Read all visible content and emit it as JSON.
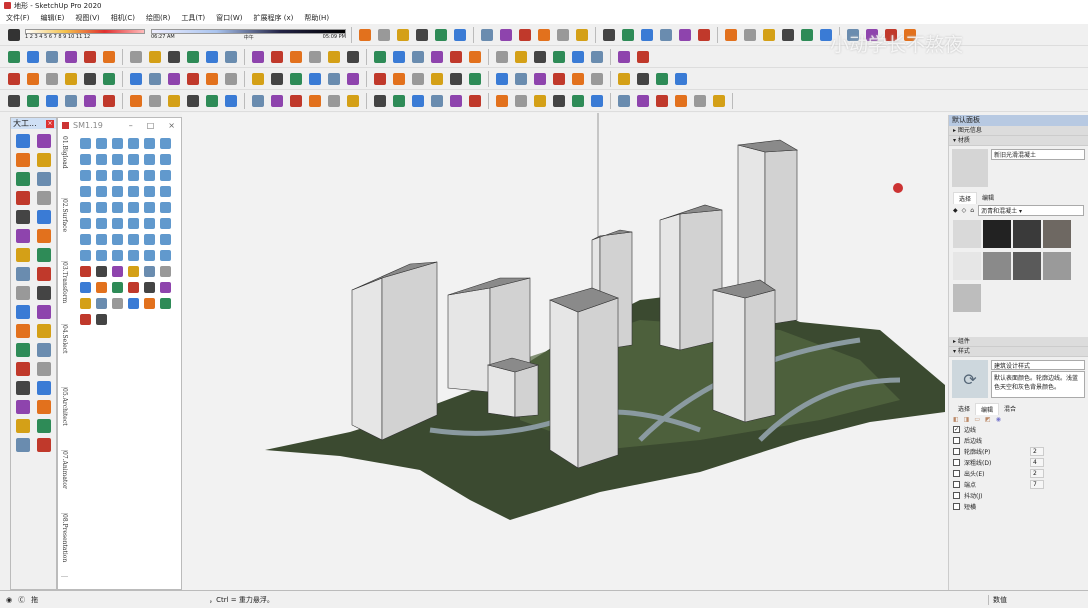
{
  "window": {
    "title": "地形 - SketchUp Pro 2020"
  },
  "menu": [
    "文件(F)",
    "编辑(E)",
    "视图(V)",
    "相机(C)",
    "绘图(R)",
    "工具(T)",
    "窗口(W)",
    "扩展程序 (x)",
    "帮助(H)"
  ],
  "shadow": {
    "months": "1 2 3 4 5 6 7 8 9 10 11 12",
    "start_time": "06:27 AM",
    "mid_time": "中午",
    "end_time": "05:09 PM"
  },
  "watermark": "小动学长不熬夜",
  "tray": {
    "title": "大工..."
  },
  "sm_panel": {
    "title": "SM1.19",
    "tabs": [
      "01.Bigload",
      "02.Surface",
      "03.Transform",
      "04.Select",
      "05.Architect",
      "07.Animator",
      "08.Presentation"
    ]
  },
  "right_panel": {
    "title": "默认面板",
    "entity_info": "图元信息",
    "materials": {
      "header": "材质",
      "name": "新旧光滑混凝土",
      "tabs": [
        "选择",
        "编辑"
      ],
      "library": "沥青和混凝土",
      "swatch_colors": [
        "#d9d9d9",
        "#222222",
        "#3a3a3a",
        "#6e6862",
        "#e6e6e6",
        "#8a8a8a",
        "#5a5a5a",
        "#9a9a9a",
        "#bdbdbd"
      ]
    },
    "components": "组件",
    "styles": {
      "header": "样式",
      "name": "建筑设计样式",
      "description": "默认表面颜色。轮廓边线。浅蓝色天空和灰色背景颜色。",
      "tabs": [
        "选择",
        "编辑",
        "混合"
      ],
      "options": [
        {
          "label": "边线",
          "checked": true
        },
        {
          "label": "后边线",
          "checked": false
        },
        {
          "label": "轮廓线(P)",
          "checked": false,
          "value": "2"
        },
        {
          "label": "深粗线(D)",
          "checked": false,
          "value": "4"
        },
        {
          "label": "出头(E)",
          "checked": false,
          "value": "2"
        },
        {
          "label": "端点",
          "checked": false,
          "value": "7"
        },
        {
          "label": "抖动(J)",
          "checked": false
        },
        {
          "label": "短横",
          "checked": false
        }
      ]
    }
  },
  "status": {
    "hint_left": "拖",
    "hint_right": "，Ctrl = 重力悬浮。",
    "measurements_label": "数值"
  }
}
